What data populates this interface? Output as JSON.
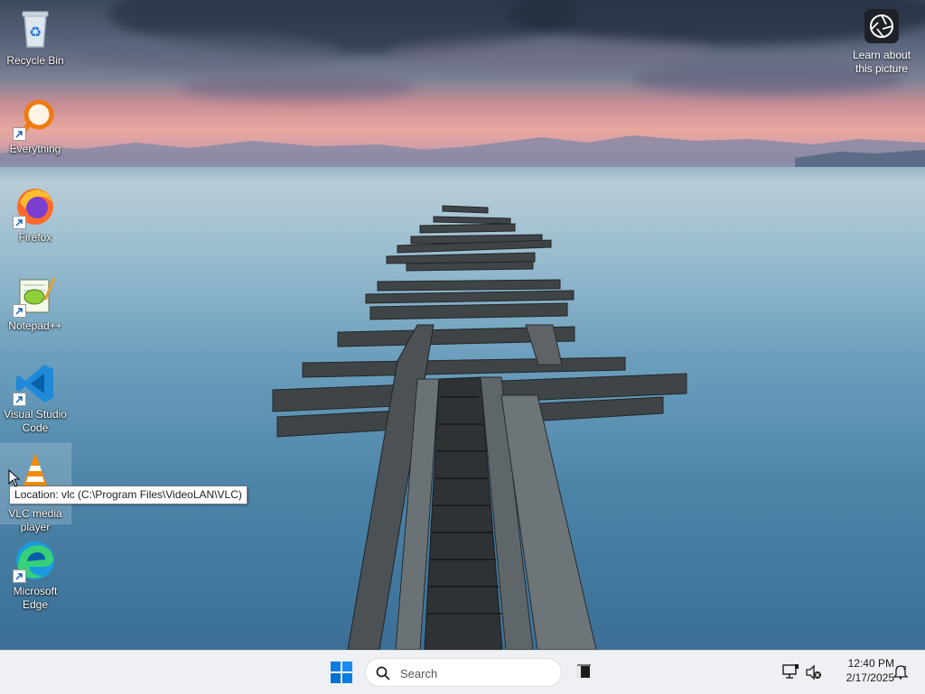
{
  "desktop": {
    "icons": [
      {
        "label": "Recycle Bin",
        "icon": "recycle-bin-icon"
      },
      {
        "label": "Everything",
        "icon": "everything-search-icon"
      },
      {
        "label": "Firefox",
        "icon": "firefox-icon"
      },
      {
        "label": "Notepad++",
        "icon": "notepad-plus-plus-icon"
      },
      {
        "label": "Visual Studio Code",
        "icon": "vscode-icon"
      },
      {
        "label": "VLC media player",
        "icon": "vlc-icon"
      },
      {
        "label": "Microsoft Edge",
        "icon": "edge-icon"
      }
    ],
    "learn_about": "Learn about this picture",
    "tooltip": "Location: vlc (C:\\Program Files\\VideoLAN\\VLC)"
  },
  "taskbar": {
    "search_placeholder": "Search",
    "time": "12:40 PM",
    "date": "2/17/2025"
  },
  "colors": {
    "taskbar_bg": "#eef0f3",
    "start_blue": "#0078d4"
  }
}
